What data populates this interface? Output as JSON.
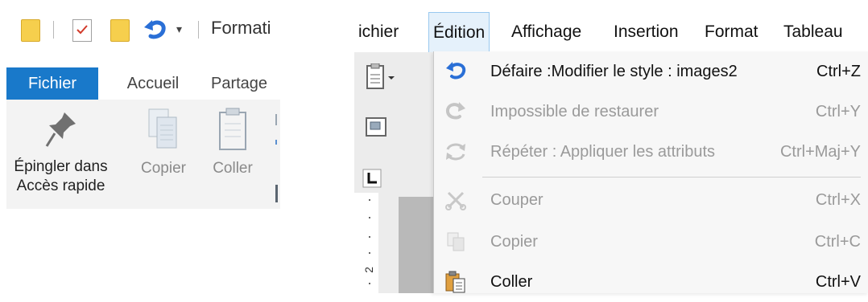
{
  "explorer": {
    "quick_access_toolbar": {
      "title_fragment": "Formati",
      "dropdown_glyph": "▾"
    },
    "tabs": [
      {
        "label": "Fichier",
        "active": true
      },
      {
        "label": "Accueil",
        "active": false
      },
      {
        "label": "Partage",
        "active": false
      }
    ],
    "ribbon": {
      "pin": {
        "label_line1": "Épingler dans",
        "label_line2": "Accès rapide",
        "icon": "pin-icon"
      },
      "copy": {
        "label": "Copier",
        "icon": "copy-icon"
      },
      "paste": {
        "label": "Coller",
        "icon": "clipboard-icon"
      }
    }
  },
  "writer": {
    "menubar": [
      {
        "label": "ichier",
        "id": "fichier"
      },
      {
        "label": "Édition",
        "id": "edition",
        "open": true
      },
      {
        "label": "Affichage",
        "id": "affichage"
      },
      {
        "label": "Insertion",
        "id": "insertion"
      },
      {
        "label": "Format",
        "id": "format"
      },
      {
        "label": "Tableau",
        "id": "tableau"
      }
    ],
    "ruler_number": "2",
    "edit_menu": [
      {
        "label": "Défaire :Modifier le style : images2",
        "shortcut": "Ctrl+Z",
        "enabled": true,
        "icon": "undo-icon"
      },
      {
        "label": "Impossible de restaurer",
        "shortcut": "Ctrl+Y",
        "enabled": false,
        "icon": "redo-icon"
      },
      {
        "label": "Répéter : Appliquer les attributs",
        "shortcut": "Ctrl+Maj+Y",
        "enabled": false,
        "icon": "repeat-icon"
      },
      {
        "label": "Couper",
        "shortcut": "Ctrl+X",
        "enabled": false,
        "icon": "scissors-icon"
      },
      {
        "label": "Copier",
        "shortcut": "Ctrl+C",
        "enabled": false,
        "icon": "copy-icon"
      },
      {
        "label": "Coller",
        "shortcut": "Ctrl+V",
        "enabled": true,
        "icon": "paste-icon"
      }
    ]
  },
  "colors": {
    "active_tab": "#1979ca",
    "ribbon_bg": "#f3f3f3",
    "menu_highlight": "#e5f1fb",
    "disabled_text": "#9a9a9a",
    "folder": "#f6cf4d",
    "undo_blue": "#2a6fd6"
  }
}
